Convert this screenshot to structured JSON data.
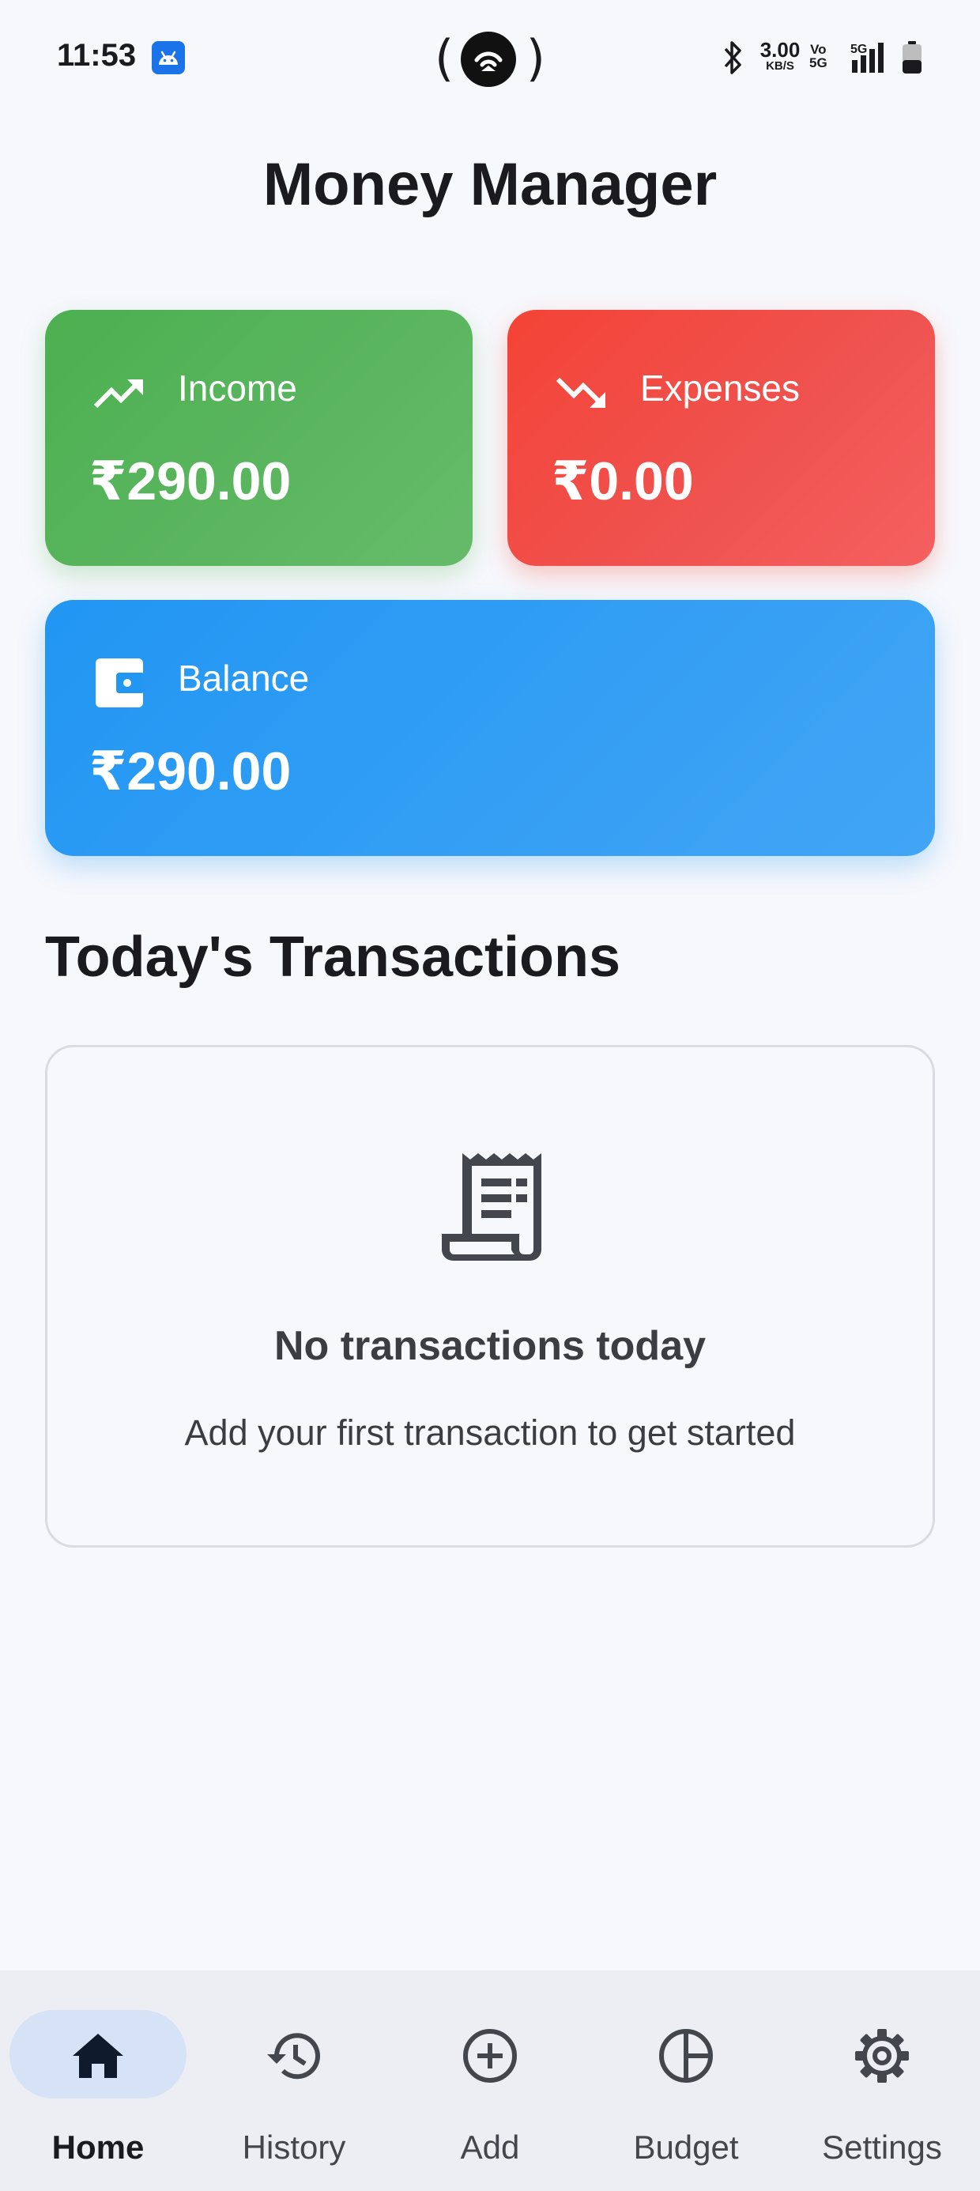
{
  "status_bar": {
    "time": "11:53",
    "net_speed_value": "3.00",
    "net_speed_unit": "KB/S",
    "network_type": "5G",
    "icons": [
      "android-icon",
      "hotspot-icon",
      "bluetooth-icon",
      "volte-icon",
      "signal-icon",
      "battery-icon"
    ]
  },
  "header": {
    "title": "Money Manager"
  },
  "summary": {
    "income": {
      "label": "Income",
      "value": "₹290.00",
      "icon": "trending-up-icon",
      "color": "#4caf50"
    },
    "expenses": {
      "label": "Expenses",
      "value": "₹0.00",
      "icon": "trending-down-icon",
      "color": "#f44336"
    },
    "balance": {
      "label": "Balance",
      "value": "₹290.00",
      "icon": "wallet-icon",
      "color": "#2196f3"
    }
  },
  "transactions": {
    "section_title": "Today's Transactions",
    "empty_title": "No transactions today",
    "empty_subtitle": "Add your first transaction to get started",
    "empty_icon": "receipt-icon"
  },
  "bottom_nav": {
    "active": "Home",
    "items": [
      {
        "label": "Home",
        "icon": "home-icon"
      },
      {
        "label": "History",
        "icon": "history-icon"
      },
      {
        "label": "Add",
        "icon": "add-circle-icon"
      },
      {
        "label": "Budget",
        "icon": "budget-pie-icon"
      },
      {
        "label": "Settings",
        "icon": "gear-icon"
      }
    ]
  }
}
